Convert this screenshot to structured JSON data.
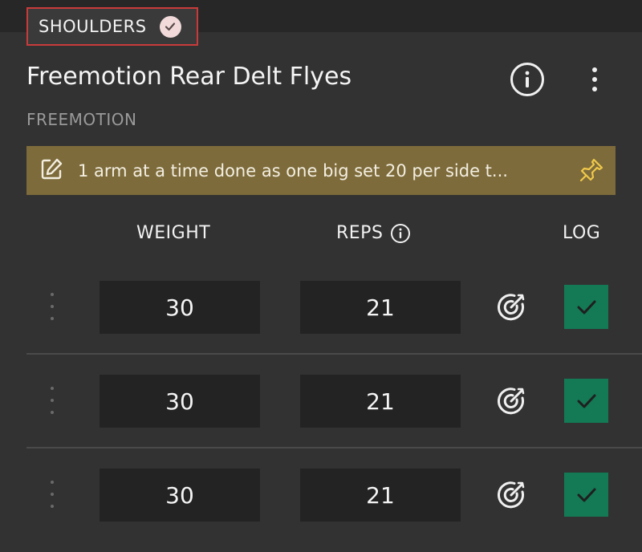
{
  "exercise": {
    "category_tag": "SHOULDERS",
    "name": "Freemotion Rear Delt Flyes",
    "brand": "FREEMOTION",
    "note": "1 arm at a time done as one big set 20 per side t..."
  },
  "table": {
    "headers": {
      "weight": "WEIGHT",
      "reps": "REPS",
      "log": "LOG"
    },
    "rows": [
      {
        "weight": "30",
        "reps": "21",
        "logged": true
      },
      {
        "weight": "30",
        "reps": "21",
        "logged": true
      },
      {
        "weight": "30",
        "reps": "21",
        "logged": true
      }
    ]
  },
  "colors": {
    "background": "#323232",
    "note_bg": "#7d6b3b",
    "log_checked": "#137a55",
    "tag_border": "#c93b3b"
  },
  "icons": [
    "check-circle-icon",
    "info-icon",
    "more-vert-icon",
    "edit-note-icon",
    "pin-icon",
    "drag-handle-icon",
    "target-icon",
    "check-icon"
  ]
}
